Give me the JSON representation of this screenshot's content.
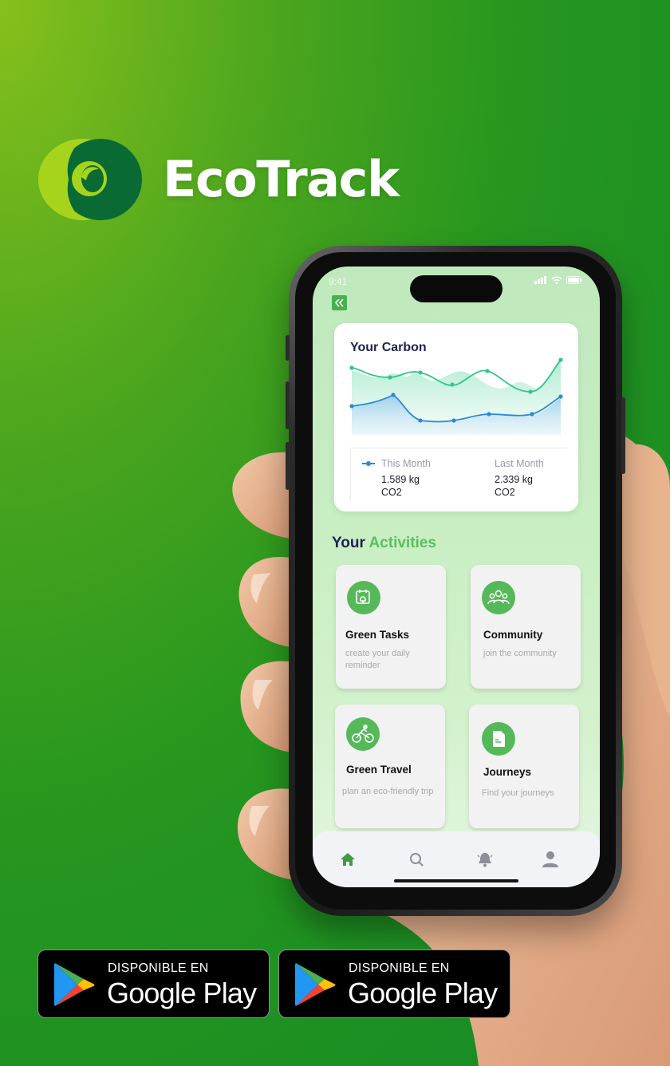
{
  "brand": {
    "name": "EcoTrack",
    "logo_icon": "eco-ring-logo"
  },
  "phone": {
    "status_time": "9:41",
    "back_icon": "double-chevron-left-icon",
    "carbon_card": {
      "title": "Your Carbon",
      "legend": {
        "this_month_label": "This Month",
        "this_month_value": "1.589 kg",
        "this_month_unit": "CO2",
        "last_month_label": "Last Month",
        "last_month_value": "2.339 kg",
        "last_month_unit": "CO2"
      },
      "colors": {
        "this_month": "#2b88d8",
        "last_month": "#35c489"
      }
    },
    "activities": {
      "title_part1": "Your",
      "title_part2": "Activities",
      "tiles": [
        {
          "title": "Green Tasks",
          "subtitle": "create your daily reminder",
          "icon": "calendar-bell-icon"
        },
        {
          "title": "Community",
          "subtitle": "join the community",
          "icon": "people-group-icon"
        },
        {
          "title": "Green Travel",
          "subtitle": "plan an eco-friendly trip",
          "icon": "cyclist-icon"
        },
        {
          "title": "Journeys",
          "subtitle": "Find your journeys",
          "icon": "document-icon"
        }
      ]
    },
    "bottom_nav": [
      "home-icon",
      "search-icon",
      "bell-icon",
      "profile-icon"
    ]
  },
  "badges": [
    {
      "top": "DISPONIBLE EN",
      "main": "Google Play"
    },
    {
      "top": "DISPONIBLE EN",
      "main": "Google Play"
    }
  ],
  "theme": {
    "accent": "#55b95a",
    "background": "#26961f",
    "title_navy": "#1e2352"
  }
}
